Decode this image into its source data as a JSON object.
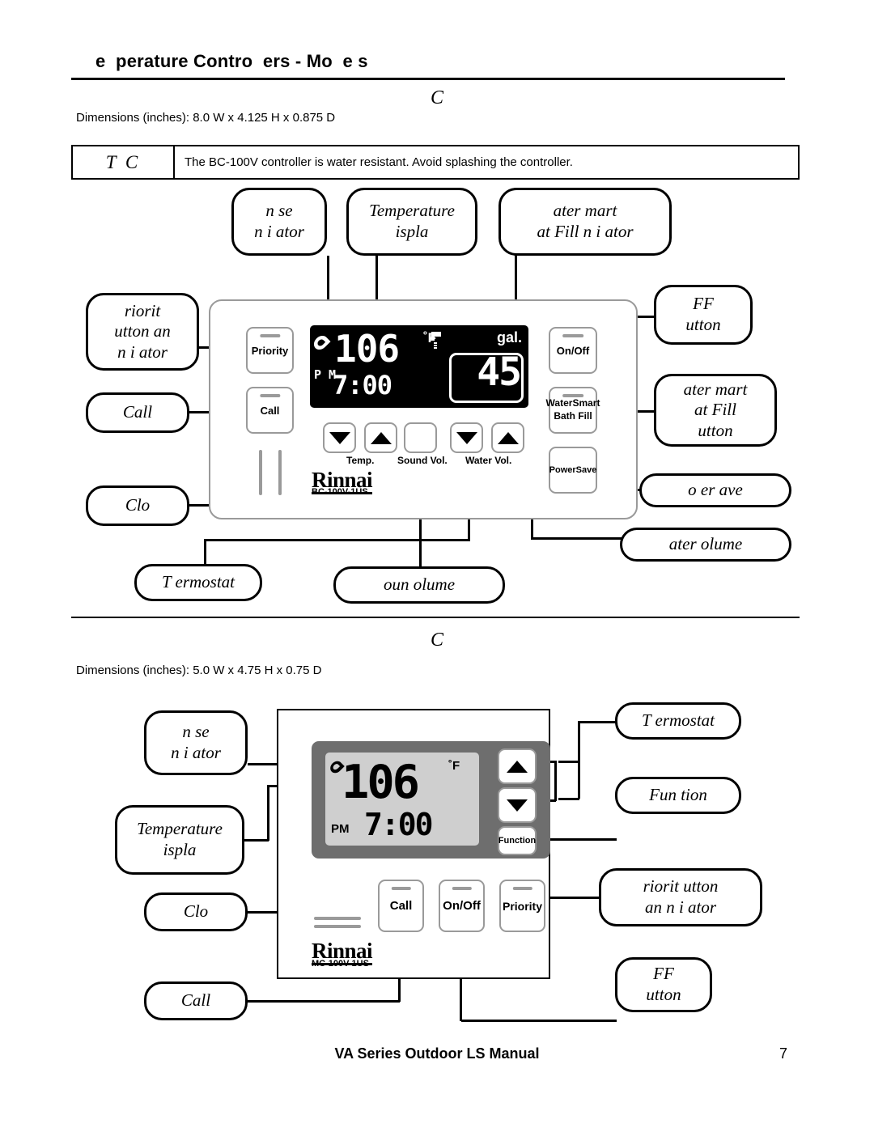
{
  "header": {
    "title": "e  perature Contro  ers - Mo  e s"
  },
  "section1": {
    "model_heading": "C",
    "dimensions": "Dimensions (inches):  8.0 W x 4.125 H x 0.875 D",
    "notice": {
      "tag": "T C",
      "text": "The BC-100V controller is water resistant.  Avoid splashing the controller."
    },
    "device": {
      "brand": "Rinnai",
      "model_number": "BC-100V-1US",
      "lcd": {
        "temperature": "106",
        "temp_unit": "˚F",
        "ampm": "P\nM",
        "clock": "7:00",
        "volume_unit": "gal.",
        "volume_value": "45"
      },
      "buttons": {
        "priority": "Priority",
        "call": "Call",
        "onoff": "On/Off",
        "watersmart": "WaterSmart\nBath Fill",
        "powersave": "PowerSave"
      },
      "control_labels": {
        "temp": "Temp.",
        "sound_vol": "Sound Vol.",
        "water_vol": "Water Vol."
      }
    },
    "callouts": {
      "in_use": "n  se\nn i  ator",
      "temp_display": "Temperature\n ispla",
      "watersmart_ind": "ater  mart\n at  Fill n i  ator",
      "priority_btn": " riorit\n utton an\n n i  ator",
      "call": "Call",
      "clock": "Clo",
      "onoff_btn": " FF\n utton",
      "watersmart_btn": " ater  mart\n at  Fill\n utton",
      "powersave": " o  er  ave",
      "water_volume": " ater  olume",
      "thermostat": "T ermostat",
      "sound_volume": " oun   olume"
    }
  },
  "section2": {
    "model_heading": "C",
    "dimensions": "Dimensions (inches):  5.0 W x 4.75 H x 0.75 D",
    "device": {
      "brand": "Rinnai",
      "model_number": "MC-100V-1US",
      "lcd": {
        "temperature": "106",
        "temp_unit": "˚F",
        "ampm": "PM",
        "clock": "7:00"
      },
      "buttons": {
        "function": "Function",
        "call": "Call",
        "onoff": "On/Off",
        "priority": "Priority"
      }
    },
    "callouts": {
      "in_use": "n  se\nn i  ator",
      "temp_display": "Temperature\n ispla",
      "clock": "Clo",
      "call": "Call",
      "thermostat": "T ermostat",
      "function": "Fun tion",
      "priority_ind": " riorit   utton\n an  n i  ator",
      "onoff_btn": " FF\n utton"
    }
  },
  "footer": {
    "manual_name": "VA Series Outdoor LS Manual",
    "page_number": "7"
  }
}
